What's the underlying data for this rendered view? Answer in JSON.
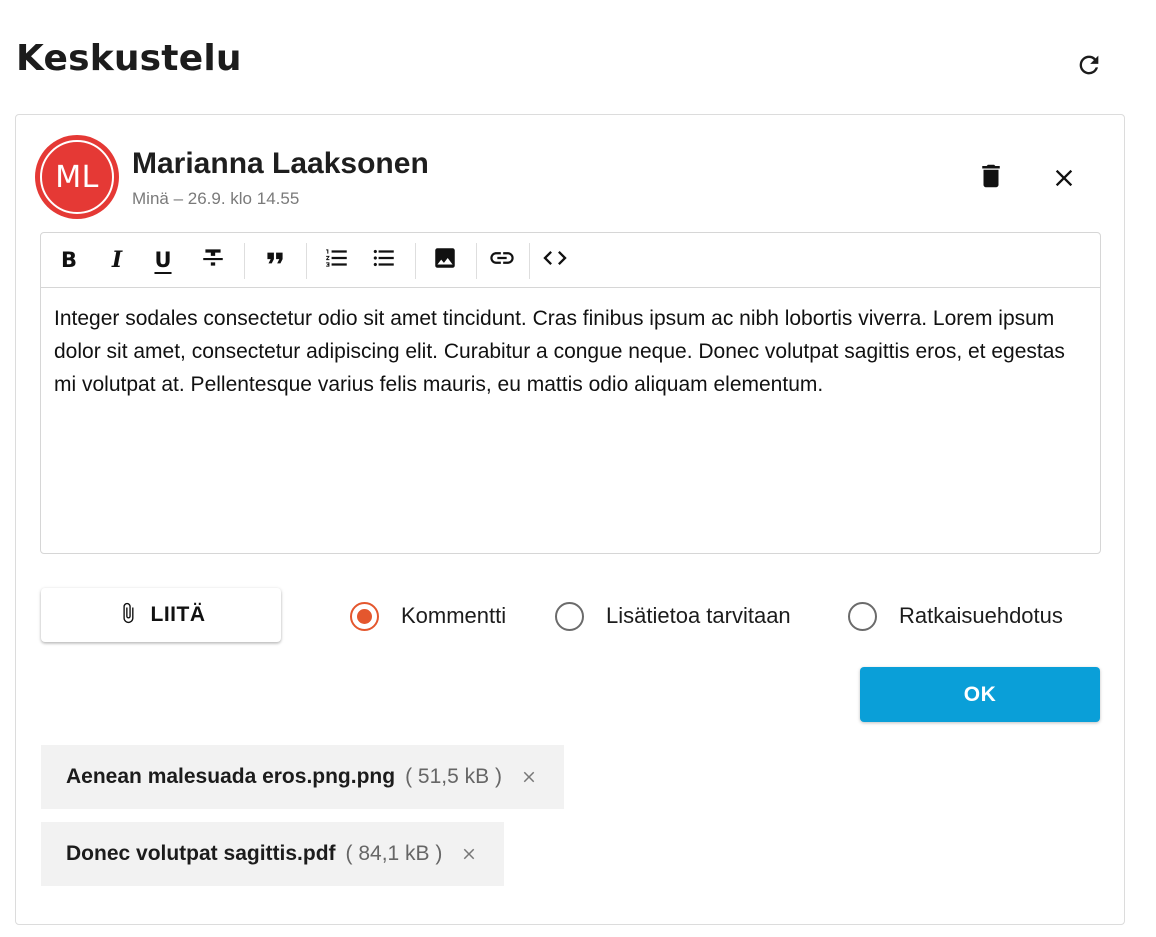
{
  "page": {
    "title": "Keskustelu"
  },
  "icons": {
    "refresh": "refresh-icon",
    "delete": "trash-icon",
    "close": "close-icon",
    "attach": "paperclip-icon",
    "remove": "close-small-icon"
  },
  "comment": {
    "avatar_initials": "ML",
    "avatar_color": "#e53935",
    "author": "Marianna Laaksonen",
    "meta": "Minä – 26.9. klo 14.55"
  },
  "editor": {
    "toolbar": [
      "bold",
      "italic",
      "underline",
      "strikethrough",
      "quote",
      "ordered-list",
      "bullet-list",
      "image",
      "link",
      "code"
    ],
    "bold_label": "B",
    "italic_label": "I",
    "underline_label": "U",
    "body": "Integer sodales consectetur odio sit amet tincidunt. Cras finibus ipsum ac nibh lobortis viverra. Lorem ipsum dolor sit amet, consectetur adipiscing elit. Curabitur a congue neque. Donec volutpat sagittis eros, et egestas mi volutpat at. Pellentesque varius felis mauris, eu mattis odio aliquam elementum."
  },
  "actions": {
    "attach_label": "LIITÄ",
    "ok_label": "OK",
    "ok_color": "#0a9fd8"
  },
  "comment_type": {
    "selected": "Kommentti",
    "options": [
      "Kommentti",
      "Lisätietoa tarvitaan",
      "Ratkaisuehdotus"
    ],
    "accent_color": "#e4572e"
  },
  "attachments": [
    {
      "name": "Aenean malesuada eros.png.png",
      "size": "( 51,5 kB )"
    },
    {
      "name": "Donec volutpat sagittis.pdf",
      "size": "( 84,1 kB )"
    }
  ]
}
